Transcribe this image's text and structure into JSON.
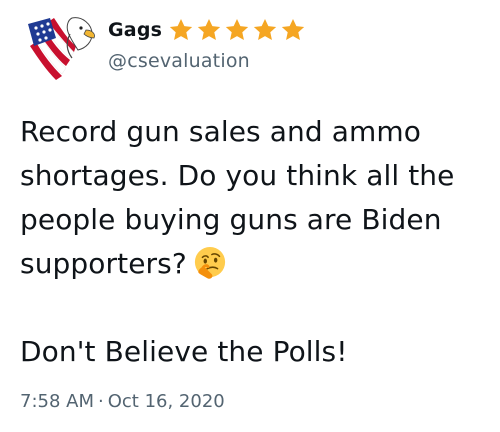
{
  "tweet": {
    "display_name": "Gags",
    "handle": "@csevaluation",
    "verified_badges": [
      "star-icon",
      "star-icon",
      "star-icon",
      "star-icon",
      "star-icon"
    ],
    "star_color": "#f5a623",
    "text_line1": "Record gun sales and ammo shortages. Do you think all the people buying guns are Biden supporters?",
    "emoji": "thinking-face-emoji",
    "text_line2": "Don't Believe the Polls!",
    "time": "7:58 AM",
    "separator": "·",
    "date": "Oct 16, 2020"
  }
}
